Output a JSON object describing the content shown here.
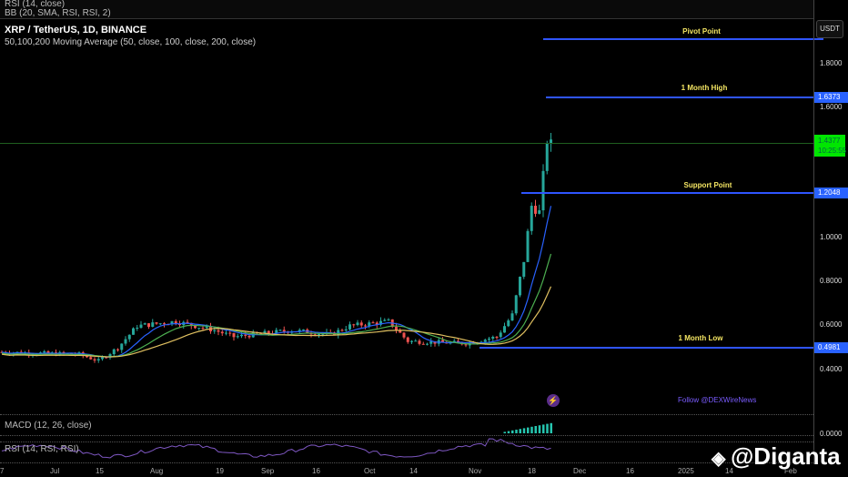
{
  "header": {
    "top_pane_labels": [
      "RSI (14, close)",
      "BB (20, SMA, RSI, RSI, 2)"
    ],
    "title": "XRP / TetherUS, 1D, BINANCE",
    "indicator": "50,100,200 Moving Average (50, close, 100, close, 200, close)"
  },
  "price_axis": {
    "currency": "USDT",
    "ticks": [
      "1.8000",
      "1.6000",
      "1.0000",
      "0.8000",
      "0.6000",
      "0.4000"
    ],
    "macd_zero": "0.0000",
    "current_price": "1.4377",
    "countdown": "10:25:55",
    "tags": {
      "high": "1.6373",
      "support": "1.2048",
      "low": "0.4981"
    }
  },
  "annotations": {
    "pivot": "Pivot Point",
    "high": "1 Month High",
    "support": "Support Point",
    "low": "1 Month Low",
    "follow": "Follow @DEXWireNews"
  },
  "panes": {
    "macd": "MACD (12, 26, close)",
    "rsi": "RSI (14, RSI, RSI)"
  },
  "x_axis": [
    "7",
    "Jul",
    "15",
    "Aug",
    "19",
    "Sep",
    "16",
    "Oct",
    "14",
    "Nov",
    "18",
    "Dec",
    "16",
    "2025",
    "14",
    "Feb"
  ],
  "watermark": "@Diganta",
  "price_series": {
    "keypoints": [
      [
        0,
        0.48
      ],
      [
        20,
        0.47
      ],
      [
        25,
        0.44
      ],
      [
        30,
        0.5
      ],
      [
        35,
        0.6
      ],
      [
        45,
        0.62
      ],
      [
        55,
        0.58
      ],
      [
        60,
        0.55
      ],
      [
        75,
        0.58
      ],
      [
        85,
        0.56
      ],
      [
        90,
        0.6
      ],
      [
        100,
        0.62
      ],
      [
        105,
        0.53
      ],
      [
        120,
        0.52
      ],
      [
        128,
        0.55
      ],
      [
        132,
        0.65
      ],
      [
        135,
        0.9
      ],
      [
        137,
        1.15
      ],
      [
        139,
        1.12
      ],
      [
        141,
        1.45
      ],
      [
        142,
        1.43
      ]
    ]
  },
  "colors": {
    "up": "#26a69a",
    "down": "#ef5350",
    "line": "#2f55ff",
    "label": "#f5e663",
    "price": "#00e600"
  }
}
